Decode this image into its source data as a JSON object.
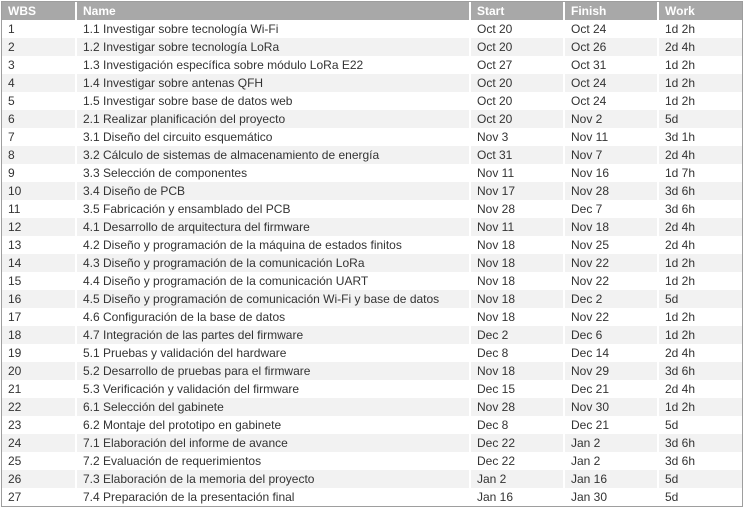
{
  "columns": {
    "wbs": "WBS",
    "name": "Name",
    "start": "Start",
    "finish": "Finish",
    "work": "Work"
  },
  "tasks": [
    {
      "wbs": "1",
      "name": "1.1 Investigar sobre tecnología Wi-Fi",
      "start": "Oct 20",
      "finish": "Oct 24",
      "work": "1d 2h"
    },
    {
      "wbs": "2",
      "name": "1.2 Investigar sobre tecnología LoRa",
      "start": "Oct 20",
      "finish": "Oct 26",
      "work": "2d 4h"
    },
    {
      "wbs": "3",
      "name": "1.3 Investigación específica sobre módulo LoRa E22",
      "start": "Oct 27",
      "finish": "Oct 31",
      "work": "1d 2h"
    },
    {
      "wbs": "4",
      "name": "1.4 Investigar sobre antenas QFH",
      "start": "Oct 20",
      "finish": "Oct 24",
      "work": "1d 2h"
    },
    {
      "wbs": "5",
      "name": "1.5 Investigar sobre base de datos web",
      "start": "Oct 20",
      "finish": "Oct 24",
      "work": "1d 2h"
    },
    {
      "wbs": "6",
      "name": "2.1 Realizar planificación del proyecto",
      "start": "Oct 20",
      "finish": "Nov 2",
      "work": "5d"
    },
    {
      "wbs": "7",
      "name": "3.1 Diseño del circuito esquemático",
      "start": "Nov 3",
      "finish": "Nov 11",
      "work": "3d 1h"
    },
    {
      "wbs": "8",
      "name": "3.2 Cálculo de sistemas de almacenamiento de energía",
      "start": "Oct 31",
      "finish": "Nov 7",
      "work": "2d 4h"
    },
    {
      "wbs": "9",
      "name": "3.3 Selección de componentes",
      "start": "Nov 11",
      "finish": "Nov 16",
      "work": "1d 7h"
    },
    {
      "wbs": "10",
      "name": "3.4 Diseño de PCB",
      "start": "Nov 17",
      "finish": "Nov 28",
      "work": "3d 6h"
    },
    {
      "wbs": "11",
      "name": "3.5 Fabricación y ensamblado del PCB",
      "start": "Nov 28",
      "finish": "Dec 7",
      "work": "3d 6h"
    },
    {
      "wbs": "12",
      "name": "4.1 Desarrollo de arquitectura del firmware",
      "start": "Nov 11",
      "finish": "Nov 18",
      "work": "2d 4h"
    },
    {
      "wbs": "13",
      "name": "4.2 Diseño y programación de la máquina de estados finitos",
      "start": "Nov 18",
      "finish": "Nov 25",
      "work": "2d 4h"
    },
    {
      "wbs": "14",
      "name": "4.3 Diseño y programación de la comunicación LoRa",
      "start": "Nov 18",
      "finish": "Nov 22",
      "work": "1d 2h"
    },
    {
      "wbs": "15",
      "name": "4.4 Diseño y programación de la comunicación UART",
      "start": "Nov 18",
      "finish": "Nov 22",
      "work": "1d 2h"
    },
    {
      "wbs": "16",
      "name": "4.5 Diseño y programación de comunicación Wi-Fi y base de datos",
      "start": "Nov 18",
      "finish": "Dec 2",
      "work": "5d"
    },
    {
      "wbs": "17",
      "name": "4.6 Configuración de la base de datos",
      "start": "Nov 18",
      "finish": "Nov 22",
      "work": "1d 2h"
    },
    {
      "wbs": "18",
      "name": "4.7 Integración de las partes del firmware",
      "start": "Dec 2",
      "finish": "Dec 6",
      "work": "1d 2h"
    },
    {
      "wbs": "19",
      "name": "5.1 Pruebas y validación del hardware",
      "start": "Dec 8",
      "finish": "Dec 14",
      "work": "2d 4h"
    },
    {
      "wbs": "20",
      "name": "5.2 Desarrollo de pruebas para el firmware",
      "start": "Nov 18",
      "finish": "Nov 29",
      "work": "3d 6h"
    },
    {
      "wbs": "21",
      "name": "5.3 Verificación y validación del firmware",
      "start": "Dec 15",
      "finish": "Dec 21",
      "work": "2d 4h"
    },
    {
      "wbs": "22",
      "name": "6.1 Selección del gabinete",
      "start": "Nov 28",
      "finish": "Nov 30",
      "work": "1d 2h"
    },
    {
      "wbs": "23",
      "name": "6.2 Montaje del prototipo en gabinete",
      "start": "Dec 8",
      "finish": "Dec 21",
      "work": "5d"
    },
    {
      "wbs": "24",
      "name": "7.1 Elaboración del informe de avance",
      "start": "Dec 22",
      "finish": "Jan 2",
      "work": "3d 6h"
    },
    {
      "wbs": "25",
      "name": "7.2 Evaluación de requerimientos",
      "start": "Dec 22",
      "finish": "Jan 2",
      "work": "3d 6h"
    },
    {
      "wbs": "26",
      "name": "7.3 Elaboración de la memoria del proyecto",
      "start": "Jan 2",
      "finish": "Jan 16",
      "work": "5d"
    },
    {
      "wbs": "27",
      "name": "7.4 Preparación de la presentación final",
      "start": "Jan 16",
      "finish": "Jan 30",
      "work": "5d"
    }
  ]
}
